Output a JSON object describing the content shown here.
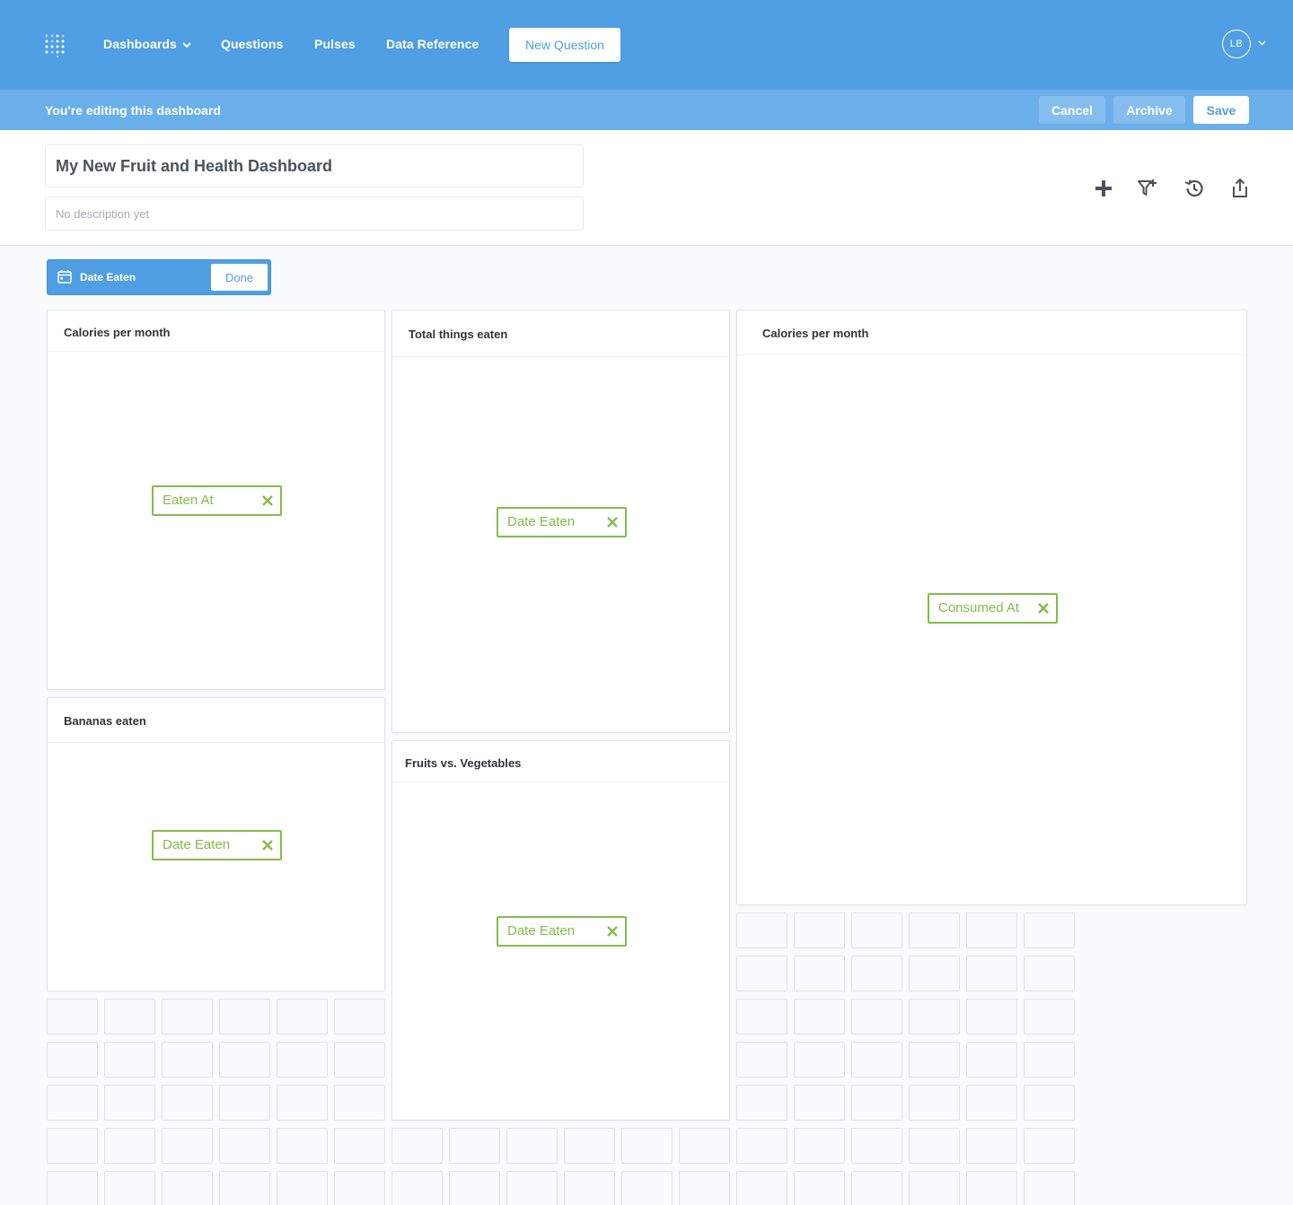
{
  "nav": {
    "logo_icon": "metabase-logo-icon",
    "links": {
      "dashboards": "Dashboards",
      "questions": "Questions",
      "pulses": "Pulses",
      "data_reference": "Data Reference"
    },
    "new_question": "New Question",
    "avatar_initials": "LB"
  },
  "editbar": {
    "message": "You're editing this dashboard",
    "cancel": "Cancel",
    "archive": "Archive",
    "save": "Save"
  },
  "dashboard": {
    "title": "My New Fruit and Health Dashboard",
    "description_placeholder": "No description yet",
    "actions": [
      "add-card-icon",
      "add-filter-icon",
      "history-icon",
      "share-icon"
    ]
  },
  "parameter": {
    "label": "Date Eaten",
    "done": "Done"
  },
  "cards": {
    "c1": {
      "title": "Calories per month",
      "target": "Eaten At"
    },
    "c2": {
      "title": "Total things eaten",
      "target": "Date Eaten"
    },
    "c3": {
      "title": "Calories per month",
      "target": "Consumed At"
    },
    "c4": {
      "title": "Bananas eaten",
      "target": "Date Eaten"
    },
    "c5": {
      "title": "Fruits vs. Vegetables",
      "target": "Date Eaten"
    }
  },
  "colors": {
    "brand": "#509ee3",
    "editbar": "#6aaeea",
    "target_green": "#84bb4c"
  }
}
